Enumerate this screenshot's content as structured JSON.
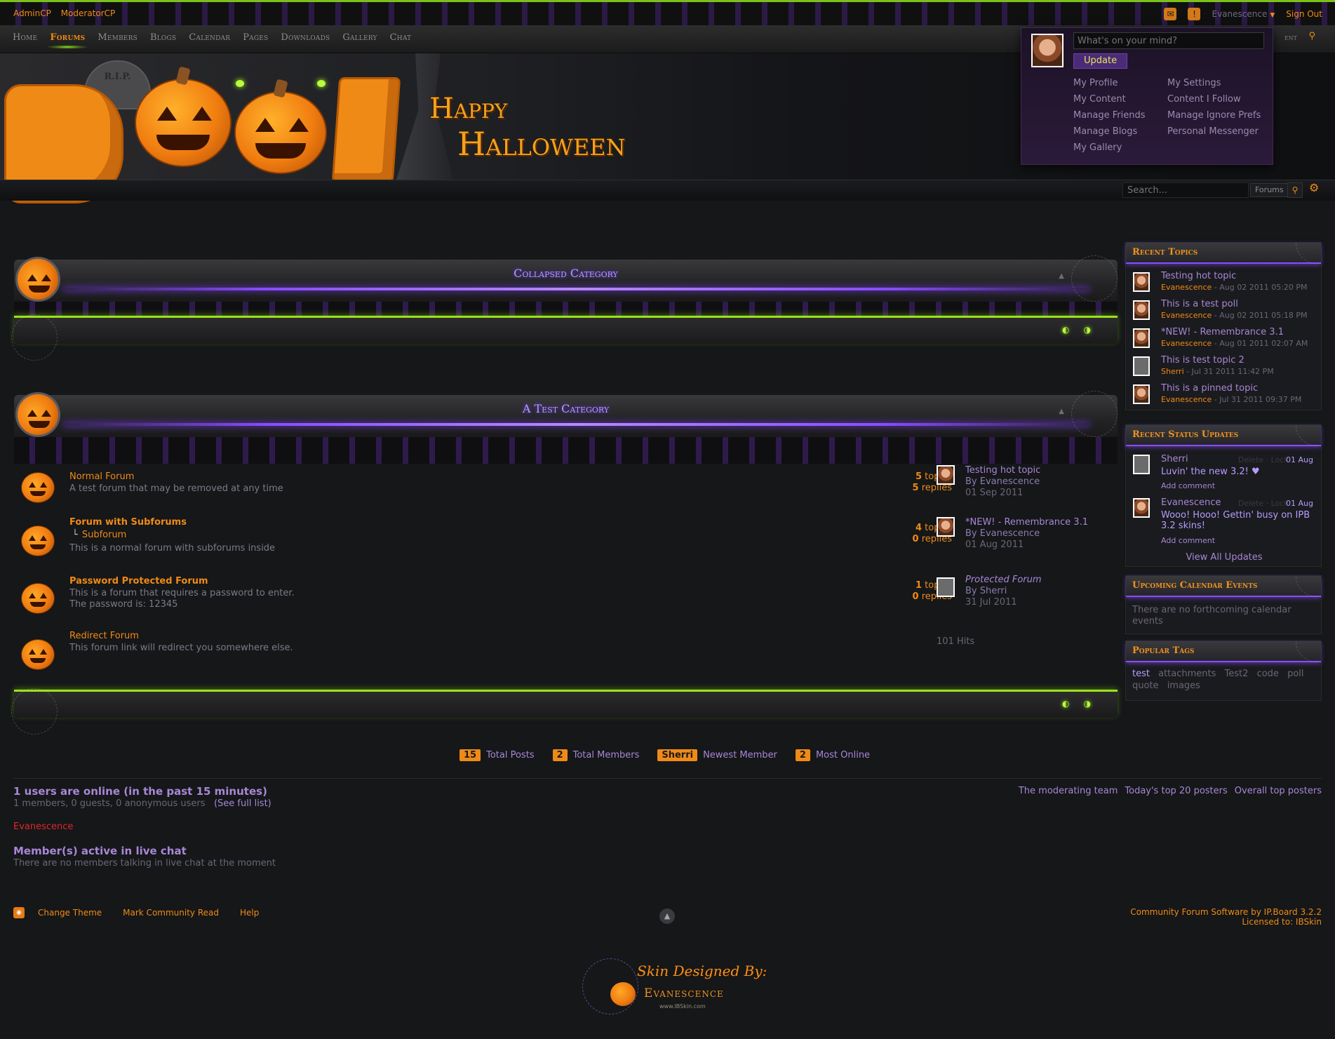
{
  "topbar": {
    "admin_cp": "AdminCP",
    "moderator_cp": "ModeratorCP",
    "user_name": "Evanescence",
    "sign_out": "Sign Out"
  },
  "nav": {
    "items": [
      "Home",
      "Forums",
      "Members",
      "Blogs",
      "Calendar",
      "Pages",
      "Downloads",
      "Gallery",
      "Chat"
    ],
    "active": "Forums",
    "partial_right": "ent"
  },
  "banner": {
    "rip": "R.I.P.",
    "happy": "Happy",
    "halloween": "Halloween"
  },
  "search": {
    "placeholder": "Search...",
    "scope": "Forums"
  },
  "user_menu": {
    "status_placeholder": "What's on your mind?",
    "update_label": "Update",
    "links": [
      "My Profile",
      "My Settings",
      "My Content",
      "Content I Follow",
      "Manage Friends",
      "Manage Ignore Prefs",
      "Manage Blogs",
      "Personal Messenger",
      "My Gallery"
    ]
  },
  "categories": [
    {
      "title": "Collapsed Category"
    },
    {
      "title": "A Test Category"
    }
  ],
  "forums": [
    {
      "name": "Normal Forum",
      "description": "A test forum that may be removed at any time",
      "topics": "5",
      "topics_label": "topics",
      "replies": "5",
      "replies_label": "replies",
      "last_title": "Testing hot topic",
      "last_by": "By Evanescence",
      "last_date": "01 Sep 2011"
    },
    {
      "name": "Forum with Subforums",
      "subforum": "Subforum",
      "description": "This is a normal forum with subforums inside",
      "topics": "4",
      "topics_label": "topics",
      "replies": "0",
      "replies_label": "replies",
      "last_title": "*NEW! - Remembrance 3.1",
      "last_by": "By Evanescence",
      "last_date": "01 Aug 2011"
    },
    {
      "name": "Password Protected Forum",
      "description": "This is a forum that requires a password to enter.",
      "description2": "The password is: 12345",
      "topics": "1",
      "topics_label": "topics",
      "replies": "0",
      "replies_label": "replies",
      "last_title": "Protected Forum",
      "last_by": "By Sherri",
      "last_date": "31 Jul 2011"
    },
    {
      "name": "Redirect Forum",
      "description": "This forum link will redirect you somewhere else.",
      "hits": "101 Hits"
    }
  ],
  "sidebar": {
    "recent_topics": {
      "title": "Recent Topics",
      "items": [
        {
          "title": "Testing hot topic",
          "author": "Evanescence",
          "date": "- Aug 02 2011 05:20 PM"
        },
        {
          "title": "This is a test poll",
          "author": "Evanescence",
          "date": "- Aug 02 2011 05:18 PM"
        },
        {
          "title": "*NEW! - Remembrance 3.1",
          "author": "Evanescence",
          "date": "- Aug 01 2011 02:07 AM"
        },
        {
          "title": "This is test topic 2",
          "author": "Sherri",
          "date": "- Jul 31 2011 11:42 PM"
        },
        {
          "title": "This is a pinned topic",
          "author": "Evanescence",
          "date": "- Jul 31 2011 09:37 PM"
        }
      ]
    },
    "status_updates": {
      "title": "Recent Status Updates",
      "items": [
        {
          "name": "Sherri",
          "date": "01 Aug",
          "text": "Luvin' the new 3.2! ♥",
          "comment": "Add comment",
          "faint": "Delete · Lock"
        },
        {
          "name": "Evanescence",
          "date": "01 Aug",
          "text": "Wooo! Hooo! Gettin' busy on IPB 3.2 skins!",
          "comment": "Add comment",
          "faint": "Delete · Lock"
        }
      ],
      "view_all": "View All Updates"
    },
    "calendar": {
      "title": "Upcoming Calendar Events",
      "text": "There are no forthcoming calendar events"
    },
    "tags": {
      "title": "Popular Tags",
      "items": [
        "test",
        "attachments",
        "Test2",
        "code",
        "poll",
        "quote",
        "images"
      ]
    }
  },
  "stats": [
    {
      "value": "15",
      "label": "Total Posts"
    },
    {
      "value": "2",
      "label": "Total Members"
    },
    {
      "value": "Sherri",
      "label": "Newest Member"
    },
    {
      "value": "2",
      "label": "Most Online"
    }
  ],
  "online": {
    "heading": "1 users are online (in the past 15 minutes)",
    "summary": "1 members, 0 guests, 0 anonymous users",
    "full_list": "(See full list)",
    "user": "Evanescence",
    "chat_heading": "Member(s) active in live chat",
    "chat_text": "There are no members talking in live chat at the moment",
    "team_links": [
      "The moderating team",
      "Today's top 20 posters",
      "Overall top posters"
    ]
  },
  "footer": {
    "links": [
      "Change Theme",
      "Mark Community Read",
      "Help"
    ],
    "copyright1": "Community Forum Software by IP.Board 3.2.2",
    "copyright2": "Licensed to: IBSkin",
    "credit1": "Skin Designed By:",
    "credit2": "Evanescence",
    "credit3": "www.IBSkin.com"
  },
  "colors": {
    "accent_orange": "#f08a16",
    "accent_purple": "#a887d6",
    "accent_green": "#9be21a",
    "background": "#151719"
  }
}
